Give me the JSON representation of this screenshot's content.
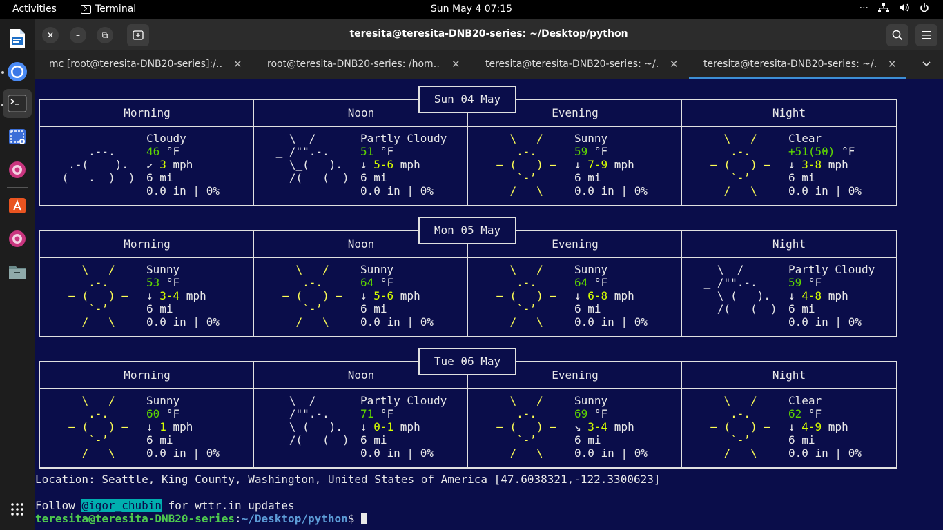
{
  "topbar": {
    "activities": "Activities",
    "app_name": "Terminal",
    "clock": "Sun May 4  07:15",
    "more": "···"
  },
  "window": {
    "title": "teresita@teresita-DNB20-series: ~/Desktop/python",
    "tabs": [
      {
        "label": "mc [root@teresita-DNB20-series]:/…"
      },
      {
        "label": "root@teresita-DNB20-series: /hom…"
      },
      {
        "label": "teresita@teresita-DNB20-series: ~/…"
      },
      {
        "label": "teresita@teresita-DNB20-series: ~/…"
      }
    ],
    "active_tab": 3
  },
  "colors": {
    "terminal_bg": "#0a0d4a",
    "temp_green": "#5fd700",
    "sun_yellow": "#ffff55",
    "tab_accent": "#3d8fd6",
    "handle_bg": "#00afaf"
  },
  "icons": {
    "dock": [
      "libreoffice-writer-icon",
      "chromium-icon",
      "terminal-icon",
      "screenshot-icon",
      "ubuntu-pink-icon",
      "app-center-icon",
      "help-icon",
      "files-icon",
      "show-apps-icon"
    ],
    "tray": [
      "network-icon",
      "volume-icon",
      "power-icon"
    ]
  },
  "terminal": {
    "periods": [
      "Morning",
      "Noon",
      "Evening",
      "Night"
    ],
    "days": [
      {
        "date": "Sun 04 May",
        "slots": [
          {
            "icon": "cloudy",
            "art": [
              "",
              "     .--.    ",
              "  .-(    ).  ",
              " (___.__)__) ",
              ""
            ],
            "condition": "Cloudy",
            "temp": "46",
            "temp_suffix": " °F",
            "wind_dir": "↙ ",
            "wind": "3",
            "wind_unit": " mph",
            "visibility": "6 mi",
            "precip": "0.0 in | 0%"
          },
          {
            "icon": "partly-cloudy",
            "art": [
              "   \\  /      ",
              " _ /\"\".-.    ",
              "   \\_(   ).  ",
              "   /(___(__) ",
              ""
            ],
            "condition": "Partly Cloudy",
            "temp": "51",
            "temp_suffix": " °F",
            "wind_dir": "↓ ",
            "wind": "5-6",
            "wind_unit": " mph",
            "visibility": "6 mi",
            "precip": "0.0 in | 0%"
          },
          {
            "icon": "sunny",
            "art": [
              "    \\   /    ",
              "     .-.     ",
              "  – (   ) –  ",
              "     `-’     ",
              "    /   \\    "
            ],
            "condition": "Sunny",
            "temp": "59",
            "temp_suffix": " °F",
            "wind_dir": "↓ ",
            "wind": "7-9",
            "wind_unit": " mph",
            "visibility": "6 mi",
            "precip": "0.0 in | 0%"
          },
          {
            "icon": "clear",
            "art": [
              "    \\   /    ",
              "     .-.     ",
              "  – (   ) –  ",
              "     `-’     ",
              "    /   \\    "
            ],
            "condition": "Clear",
            "temp": "+51(50)",
            "temp_suffix": " °F",
            "wind_dir": "↓ ",
            "wind": "3-8",
            "wind_unit": " mph",
            "visibility": "6 mi",
            "precip": "0.0 in | 0%"
          }
        ]
      },
      {
        "date": "Mon 05 May",
        "slots": [
          {
            "icon": "sunny",
            "art": [
              "    \\   /    ",
              "     .-.     ",
              "  – (   ) –  ",
              "     `-’     ",
              "    /   \\    "
            ],
            "condition": "Sunny",
            "temp": "53",
            "temp_suffix": " °F",
            "wind_dir": "↓ ",
            "wind": "3-4",
            "wind_unit": " mph",
            "visibility": "6 mi",
            "precip": "0.0 in | 0%"
          },
          {
            "icon": "sunny",
            "art": [
              "    \\   /    ",
              "     .-.     ",
              "  – (   ) –  ",
              "     `-’     ",
              "    /   \\    "
            ],
            "condition": "Sunny",
            "temp": "64",
            "temp_suffix": " °F",
            "wind_dir": "↓ ",
            "wind": "5-6",
            "wind_unit": " mph",
            "visibility": "6 mi",
            "precip": "0.0 in | 0%"
          },
          {
            "icon": "sunny",
            "art": [
              "    \\   /    ",
              "     .-.     ",
              "  – (   ) –  ",
              "     `-’     ",
              "    /   \\    "
            ],
            "condition": "Sunny",
            "temp": "64",
            "temp_suffix": " °F",
            "wind_dir": "↓ ",
            "wind": "6-8",
            "wind_unit": " mph",
            "visibility": "6 mi",
            "precip": "0.0 in | 0%"
          },
          {
            "icon": "partly-cloudy",
            "art": [
              "   \\  /      ",
              " _ /\"\".-.    ",
              "   \\_(   ).  ",
              "   /(___(__) ",
              ""
            ],
            "condition": "Partly Cloudy",
            "temp": "59",
            "temp_suffix": " °F",
            "wind_dir": "↓ ",
            "wind": "4-8",
            "wind_unit": " mph",
            "visibility": "6 mi",
            "precip": "0.0 in | 0%"
          }
        ]
      },
      {
        "date": "Tue 06 May",
        "slots": [
          {
            "icon": "sunny",
            "art": [
              "    \\   /    ",
              "     .-.     ",
              "  – (   ) –  ",
              "     `-’     ",
              "    /   \\    "
            ],
            "condition": "Sunny",
            "temp": "60",
            "temp_suffix": " °F",
            "wind_dir": "↓ ",
            "wind": "1",
            "wind_unit": " mph",
            "visibility": "6 mi",
            "precip": "0.0 in | 0%"
          },
          {
            "icon": "partly-cloudy",
            "art": [
              "   \\  /      ",
              " _ /\"\".-.    ",
              "   \\_(   ).  ",
              "   /(___(__) ",
              ""
            ],
            "condition": "Partly Cloudy",
            "temp": "71",
            "temp_suffix": " °F",
            "wind_dir": "↓ ",
            "wind": "0-1",
            "wind_unit": " mph",
            "visibility": "6 mi",
            "precip": "0.0 in | 0%"
          },
          {
            "icon": "sunny",
            "art": [
              "    \\   /    ",
              "     .-.     ",
              "  – (   ) –  ",
              "     `-’     ",
              "    /   \\    "
            ],
            "condition": "Sunny",
            "temp": "69",
            "temp_suffix": " °F",
            "wind_dir": "↘ ",
            "wind": "3-4",
            "wind_unit": " mph",
            "visibility": "6 mi",
            "precip": "0.0 in | 0%"
          },
          {
            "icon": "clear",
            "art": [
              "    \\   /    ",
              "     .-.     ",
              "  – (   ) –  ",
              "     `-’     ",
              "    /   \\    "
            ],
            "condition": "Clear",
            "temp": "62",
            "temp_suffix": " °F",
            "wind_dir": "↓ ",
            "wind": "4-9",
            "wind_unit": " mph",
            "visibility": "6 mi",
            "precip": "0.0 in | 0%"
          }
        ]
      }
    ],
    "location": "Location: Seattle, King County, Washington, United States of America [47.6038321,-122.3300623]",
    "follow_prefix": "Follow ",
    "follow_handle": "@igor_chubin",
    "follow_suffix": " for wttr.in updates",
    "prompt_user": "teresita@teresita-DNB20-series",
    "prompt_sep": ":",
    "prompt_path": "~/Desktop/python",
    "prompt_end": "$ "
  }
}
